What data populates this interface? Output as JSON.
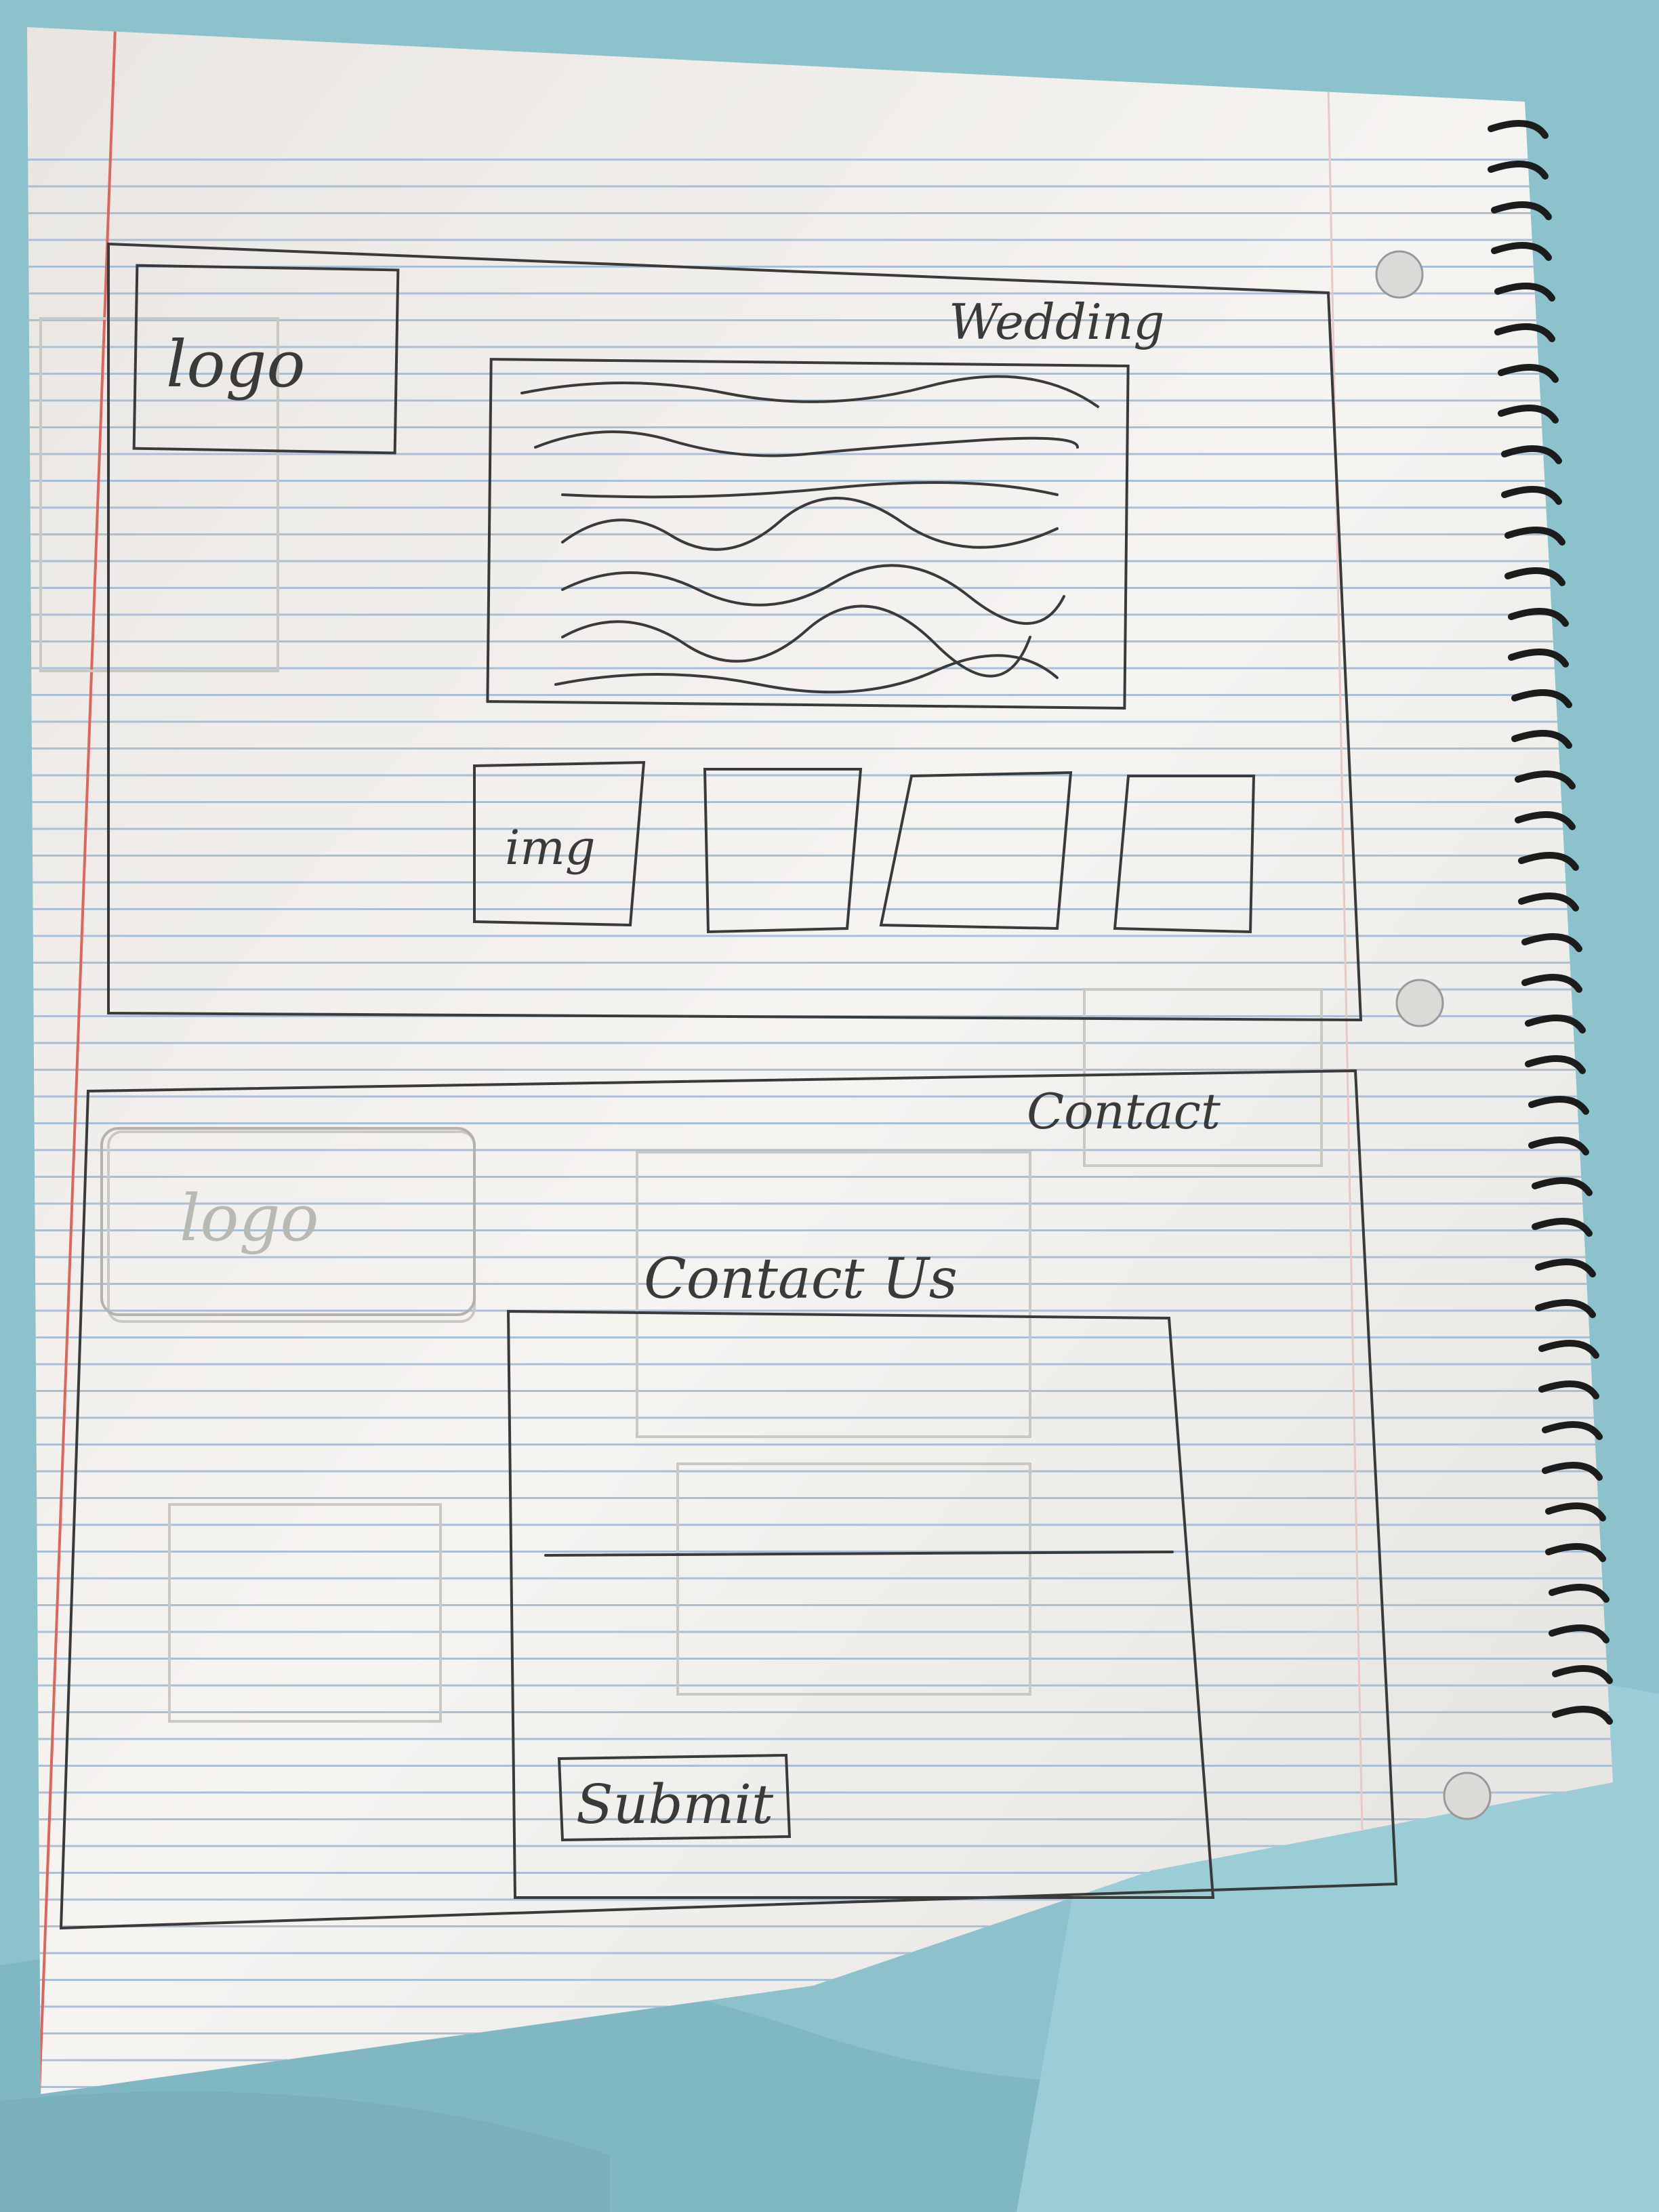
{
  "page_top": {
    "title": "Wedding",
    "logo_label": "logo",
    "image_label": "img"
  },
  "page_bottom": {
    "title": "Contact",
    "logo_label": "logo",
    "heading": "Contact Us",
    "submit_label": "Submit"
  },
  "colors": {
    "fabric": "#8fc3cc",
    "paper": "#f3f1ee",
    "rule_line": "#a9bfd6",
    "margin_line": "#e0645c",
    "pencil": "#3a3a3a"
  }
}
